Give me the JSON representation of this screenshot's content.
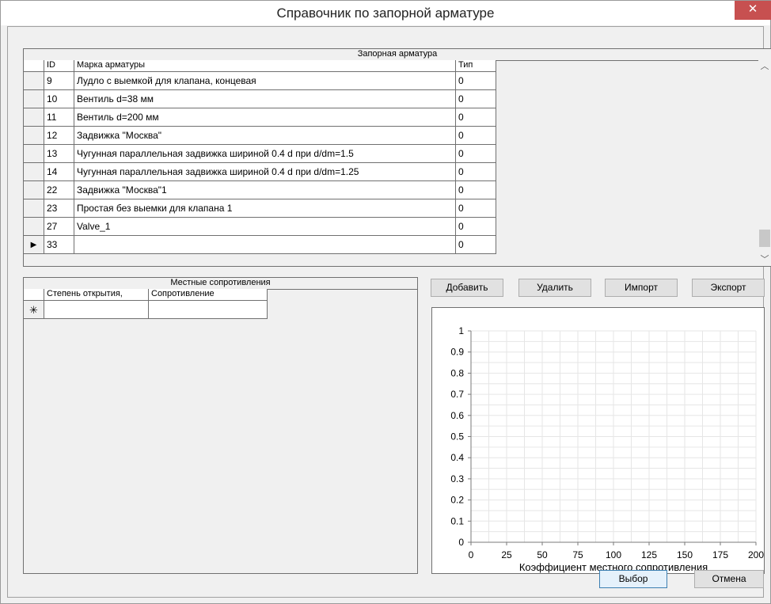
{
  "window": {
    "title": "Справочник по запорной арматуре",
    "close_glyph": "✕"
  },
  "valves": {
    "caption": "Запорная арматура",
    "columns": {
      "id": "ID",
      "name": "Марка арматуры",
      "type": "Тип"
    },
    "rows": [
      {
        "id": "9",
        "name": "Лудло с выемкой для клапана, концевая",
        "type": "0"
      },
      {
        "id": "10",
        "name": "Вентиль d=38 мм",
        "type": "0"
      },
      {
        "id": "11",
        "name": "Вентиль d=200 мм",
        "type": "0"
      },
      {
        "id": "12",
        "name": "Задвижка \"Москва\"",
        "type": "0"
      },
      {
        "id": "13",
        "name": "Чугунная параллельная задвижка шириной 0.4 d при d/dm=1.5",
        "type": "0"
      },
      {
        "id": "14",
        "name": "Чугунная параллельная задвижка шириной 0.4 d при d/dm=1.25",
        "type": "0"
      },
      {
        "id": "22",
        "name": "Задвижка \"Москва\"1",
        "type": "0"
      },
      {
        "id": "23",
        "name": "Простая без выемки для клапана 1",
        "type": "0"
      },
      {
        "id": "27",
        "name": "Valve_1",
        "type": "0"
      },
      {
        "id": "33",
        "name": "",
        "type": "0"
      }
    ],
    "current_row_marker": "▶"
  },
  "resistances": {
    "caption": "Местные сопротивления",
    "columns": {
      "opening": "Степень открытия,",
      "resistance": "Сопротивление"
    },
    "new_row_marker": "✳"
  },
  "toolbar": {
    "add": "Добавить",
    "delete": "Удалить",
    "import": "Импорт",
    "export": "Экспорт"
  },
  "footer": {
    "select": "Выбор",
    "cancel": "Отмена"
  },
  "icons": {
    "scroll_up": "chevron-up-icon",
    "scroll_down": "chevron-down-icon",
    "close": "close-icon",
    "current_row": "row-pointer-icon",
    "new_row": "asterisk-icon"
  },
  "chart_data": {
    "type": "line",
    "title": "",
    "xlabel": "Коэффициент местного сопротивления",
    "ylabel": "",
    "xlim": [
      0,
      200
    ],
    "ylim": [
      0,
      1
    ],
    "xticks": [
      "0",
      "25",
      "50",
      "75",
      "100",
      "125",
      "150",
      "175",
      "200"
    ],
    "yticks": [
      "0",
      "0.1",
      "0.2",
      "0.3",
      "0.4",
      "0.5",
      "0.6",
      "0.7",
      "0.8",
      "0.9",
      "1"
    ],
    "grid": true,
    "series": []
  }
}
